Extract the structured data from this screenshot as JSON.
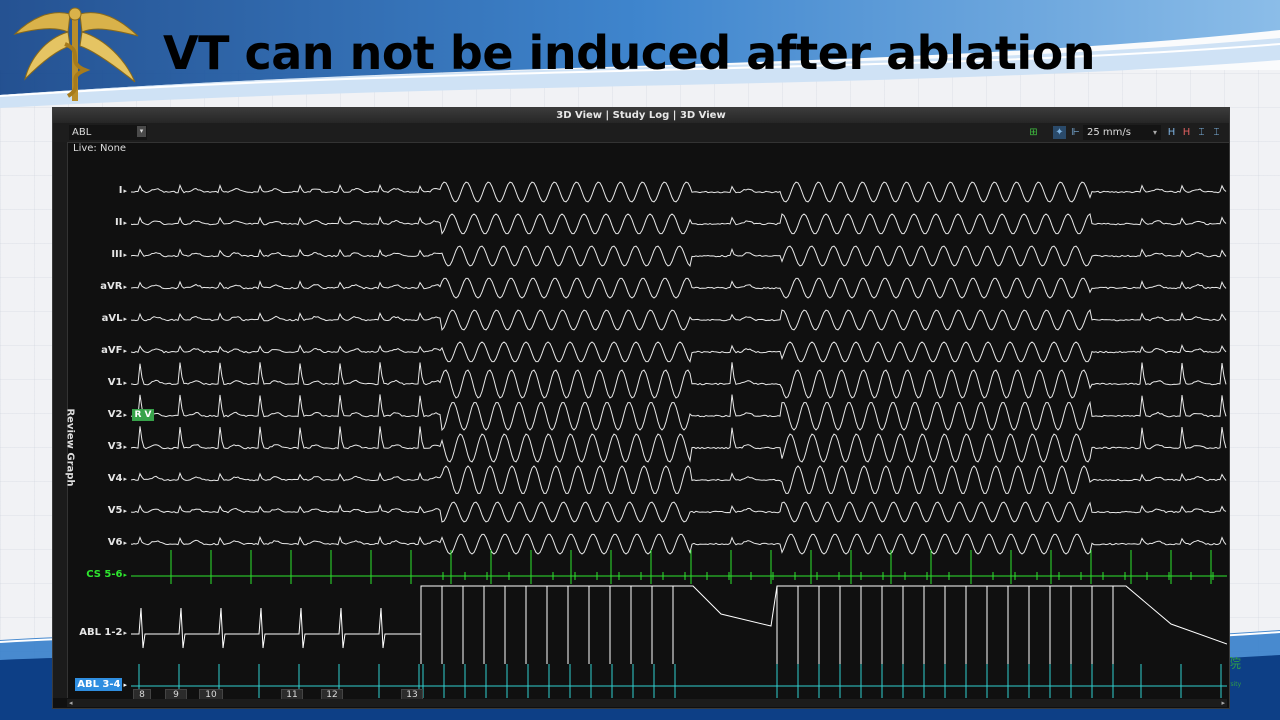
{
  "slide": {
    "title": "VT can not be induced after ablation"
  },
  "window": {
    "titlebar": "3D View | Study Log | 3D View",
    "channel_select": "ABL",
    "live_label": "Live: None",
    "sweep_speed": "25 mm/s",
    "side_tab": "Review Graph",
    "rv_tag": "R V"
  },
  "channels": [
    {
      "label": "I",
      "kind": "ecg"
    },
    {
      "label": "II",
      "kind": "ecg"
    },
    {
      "label": "III",
      "kind": "ecg"
    },
    {
      "label": "aVR",
      "kind": "ecg"
    },
    {
      "label": "aVL",
      "kind": "ecg"
    },
    {
      "label": "aVF",
      "kind": "ecg"
    },
    {
      "label": "V1",
      "kind": "ecg"
    },
    {
      "label": "V2",
      "kind": "ecg"
    },
    {
      "label": "V3",
      "kind": "ecg"
    },
    {
      "label": "V4",
      "kind": "ecg"
    },
    {
      "label": "V5",
      "kind": "ecg"
    },
    {
      "label": "V6",
      "kind": "ecg"
    },
    {
      "label": "CS 5-6",
      "kind": "cs"
    },
    {
      "label": "ABL 1-2",
      "kind": "abl"
    },
    {
      "label": "ABL 3-4",
      "kind": "abl34"
    }
  ],
  "markers": [
    "8",
    "9",
    "10",
    "11",
    "12",
    "13"
  ],
  "colors": {
    "ecg": "#e8e8e8",
    "cs": "#2ee62e",
    "abl": "#ffffff",
    "abl34": "#2fd0d0",
    "header_blue": "#1b5fb0"
  },
  "icons": {
    "toolbar": [
      "lead-add-icon",
      "caliper-icon",
      "marker-icon",
      "freeze-icon",
      "zoom-out-icon",
      "zoom-in-icon",
      "measure-icon",
      "ruler-icon"
    ],
    "caduceus": "caduceus-logo-icon"
  }
}
